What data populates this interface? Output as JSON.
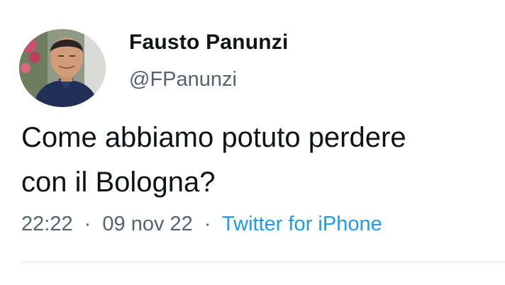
{
  "tweet": {
    "author": {
      "display_name": "Fausto Panunzi",
      "handle": "@FPanunzi",
      "avatar": "profile-photo"
    },
    "text": "Come abbiamo potuto perdere\ncon il Bologna?",
    "time": "22:22",
    "date": "09 nov 22",
    "separator": "·",
    "source": "Twitter for iPhone"
  },
  "colors": {
    "text": "#0f1419",
    "secondary": "#536471",
    "link": "#1d9bf0",
    "divider": "#e1e6ea"
  }
}
